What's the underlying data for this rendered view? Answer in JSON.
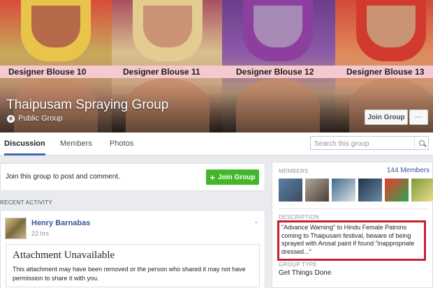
{
  "cover": {
    "panel_labels": [
      "Designer Blouse 10",
      "Designer Blouse 11",
      "Designer Blouse 12",
      "Designer Blouse 13"
    ],
    "group_title": "Thaipusam Spraying Group",
    "privacy": "Public Group",
    "join_button": "Join Group",
    "more_button": "···"
  },
  "tabs": [
    "Discussion",
    "Members",
    "Photos"
  ],
  "search": {
    "placeholder": "Search this group"
  },
  "join_prompt": {
    "text": "Join this group to post and comment.",
    "button": "Join Group",
    "plus": "+"
  },
  "recent_activity": {
    "heading": "RECENT ACTIVITY",
    "post": {
      "author": "Henry Barnabas",
      "time": "22 hrs",
      "attachment_title": "Attachment Unavailable",
      "attachment_body": "This attachment may have been removed or the person who shared it may not have permission to share it with you."
    }
  },
  "sidebar": {
    "members_heading": "MEMBERS",
    "members_count": "144 Members",
    "description_heading": "DESCRIPTION",
    "description": "\"Advance Warning\" to Hindu Female Patrons coming to Thaipusam festival, beware of being sprayed with Arosal paint if found \"inappropriate dressed...\"",
    "group_type_heading": "GROUP TYPE",
    "group_type": "Get Things Done"
  },
  "colors": {
    "link_blue": "#365899",
    "join_green": "#42b72a",
    "highlight_red": "#c8202b",
    "tab_underline": "#4267b2"
  },
  "icons": [
    "globe-icon",
    "search-icon",
    "plus-icon",
    "chevron-down-icon"
  ]
}
